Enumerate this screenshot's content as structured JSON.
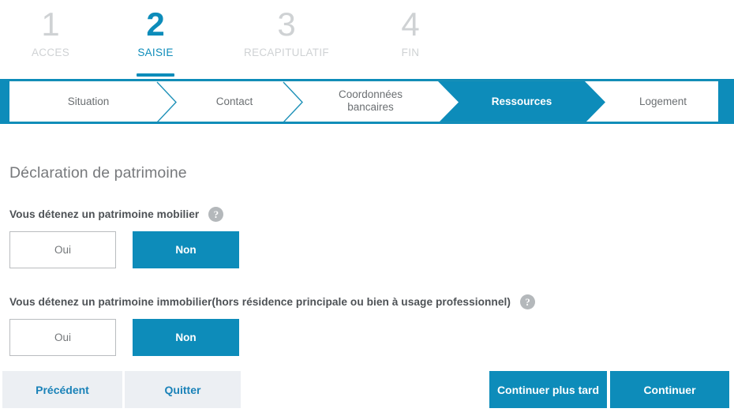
{
  "wizard": {
    "steps": [
      {
        "number": "1",
        "label": "ACCES",
        "active": false
      },
      {
        "number": "2",
        "label": "SAISIE",
        "active": true
      },
      {
        "number": "3",
        "label": "RECAPITULATIF",
        "active": false
      },
      {
        "number": "4",
        "label": "FIN",
        "active": false
      }
    ]
  },
  "breadcrumb": {
    "tabs": [
      {
        "label": "Situation",
        "active": false
      },
      {
        "label": "Contact",
        "active": false
      },
      {
        "label": "Coordonnées bancaires",
        "line1": "Coordonnées",
        "line2": "bancaires",
        "active": false
      },
      {
        "label": "Ressources",
        "active": true
      },
      {
        "label": "Logement",
        "active": false
      }
    ]
  },
  "main": {
    "page_title": "Déclaration de patrimoine",
    "questions": [
      {
        "label": "Vous détenez un patrimoine mobilier",
        "help_icon": "question-mark-circle-icon",
        "options": [
          {
            "label": "Oui",
            "selected": false
          },
          {
            "label": "Non",
            "selected": true
          }
        ]
      },
      {
        "label": "Vous détenez un patrimoine immobilier(hors résidence principale ou bien à usage professionnel)",
        "help_icon": "question-mark-circle-icon",
        "options": [
          {
            "label": "Oui",
            "selected": false
          },
          {
            "label": "Non",
            "selected": true
          }
        ]
      }
    ]
  },
  "footer": {
    "previous_label": "Précédent",
    "quit_label": "Quitter",
    "continue_later_label": "Continuer plus tard",
    "continue_label": "Continuer"
  },
  "colors": {
    "accent_blue": "#0d8cba",
    "ghost_button_bg": "#eceff3",
    "ghost_button_text": "#1a82b8",
    "inactive_step_gray": "#cfd2d4",
    "label_gray": "#4e5256",
    "title_gray": "#77797c",
    "help_icon_gray": "#b4b8bb"
  }
}
